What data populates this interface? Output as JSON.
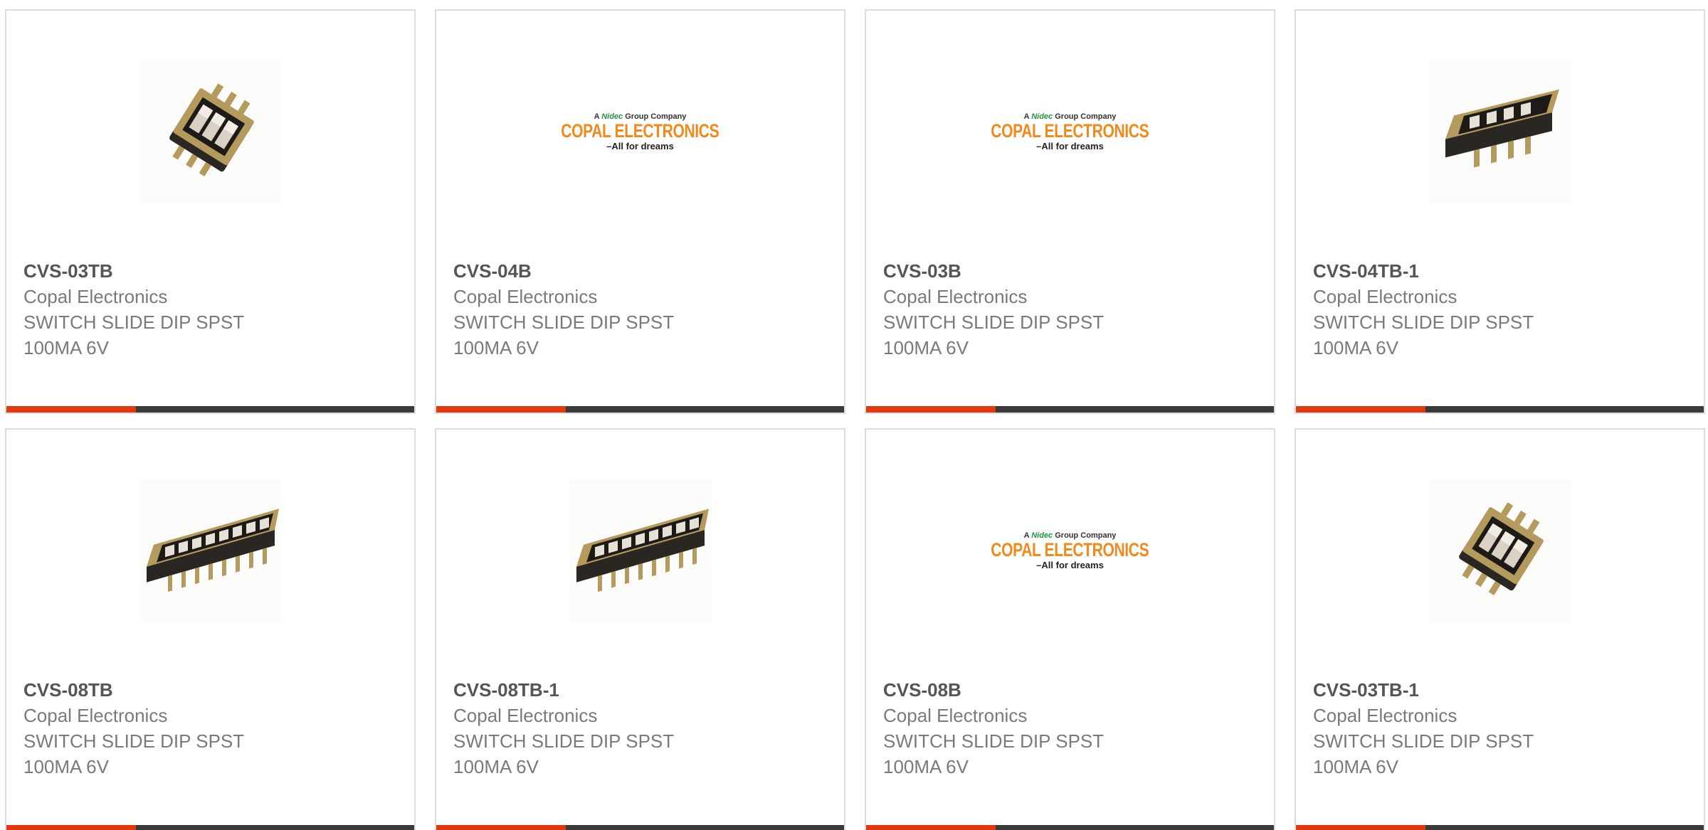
{
  "colors": {
    "accent": "#e2380f",
    "bar": "#3a3a3a",
    "border": "#dcdcdc",
    "part_text": "#555555",
    "body_text": "#7a7a7a",
    "logo_orange": "#f08a1c",
    "logo_green": "#1a9b3c"
  },
  "logo": {
    "line1_prefix": "A",
    "line1_brand": "Nidec",
    "line1_suffix": "Group Company",
    "line2": "COPAL ELECTRONICS",
    "line3": "–All for dreams"
  },
  "products": [
    {
      "part": "CVS-03TB",
      "manufacturer": "Copal Electronics",
      "description": "SWITCH SLIDE DIP SPST\n100MA 6V",
      "image": "dip-switch-3pos-angled-photo"
    },
    {
      "part": "CVS-04B",
      "manufacturer": "Copal Electronics",
      "description": "SWITCH SLIDE DIP SPST\n100MA 6V",
      "image": "copal-electronics-logo"
    },
    {
      "part": "CVS-03B",
      "manufacturer": "Copal Electronics",
      "description": "SWITCH SLIDE DIP SPST\n100MA 6V",
      "image": "copal-electronics-logo"
    },
    {
      "part": "CVS-04TB-1",
      "manufacturer": "Copal Electronics",
      "description": "SWITCH SLIDE DIP SPST\n100MA 6V",
      "image": "dip-switch-4pos-photo"
    },
    {
      "part": "CVS-08TB",
      "manufacturer": "Copal Electronics",
      "description": "SWITCH SLIDE DIP SPST\n100MA 6V",
      "image": "dip-switch-8pos-photo"
    },
    {
      "part": "CVS-08TB-1",
      "manufacturer": "Copal Electronics",
      "description": "SWITCH SLIDE DIP SPST\n100MA 6V",
      "image": "dip-switch-8pos-photo"
    },
    {
      "part": "CVS-08B",
      "manufacturer": "Copal Electronics",
      "description": "SWITCH SLIDE DIP SPST\n100MA 6V",
      "image": "copal-electronics-logo"
    },
    {
      "part": "CVS-03TB-1",
      "manufacturer": "Copal Electronics",
      "description": "SWITCH SLIDE DIP SPST\n100MA 6V",
      "image": "dip-switch-3pos-angled-photo"
    }
  ]
}
